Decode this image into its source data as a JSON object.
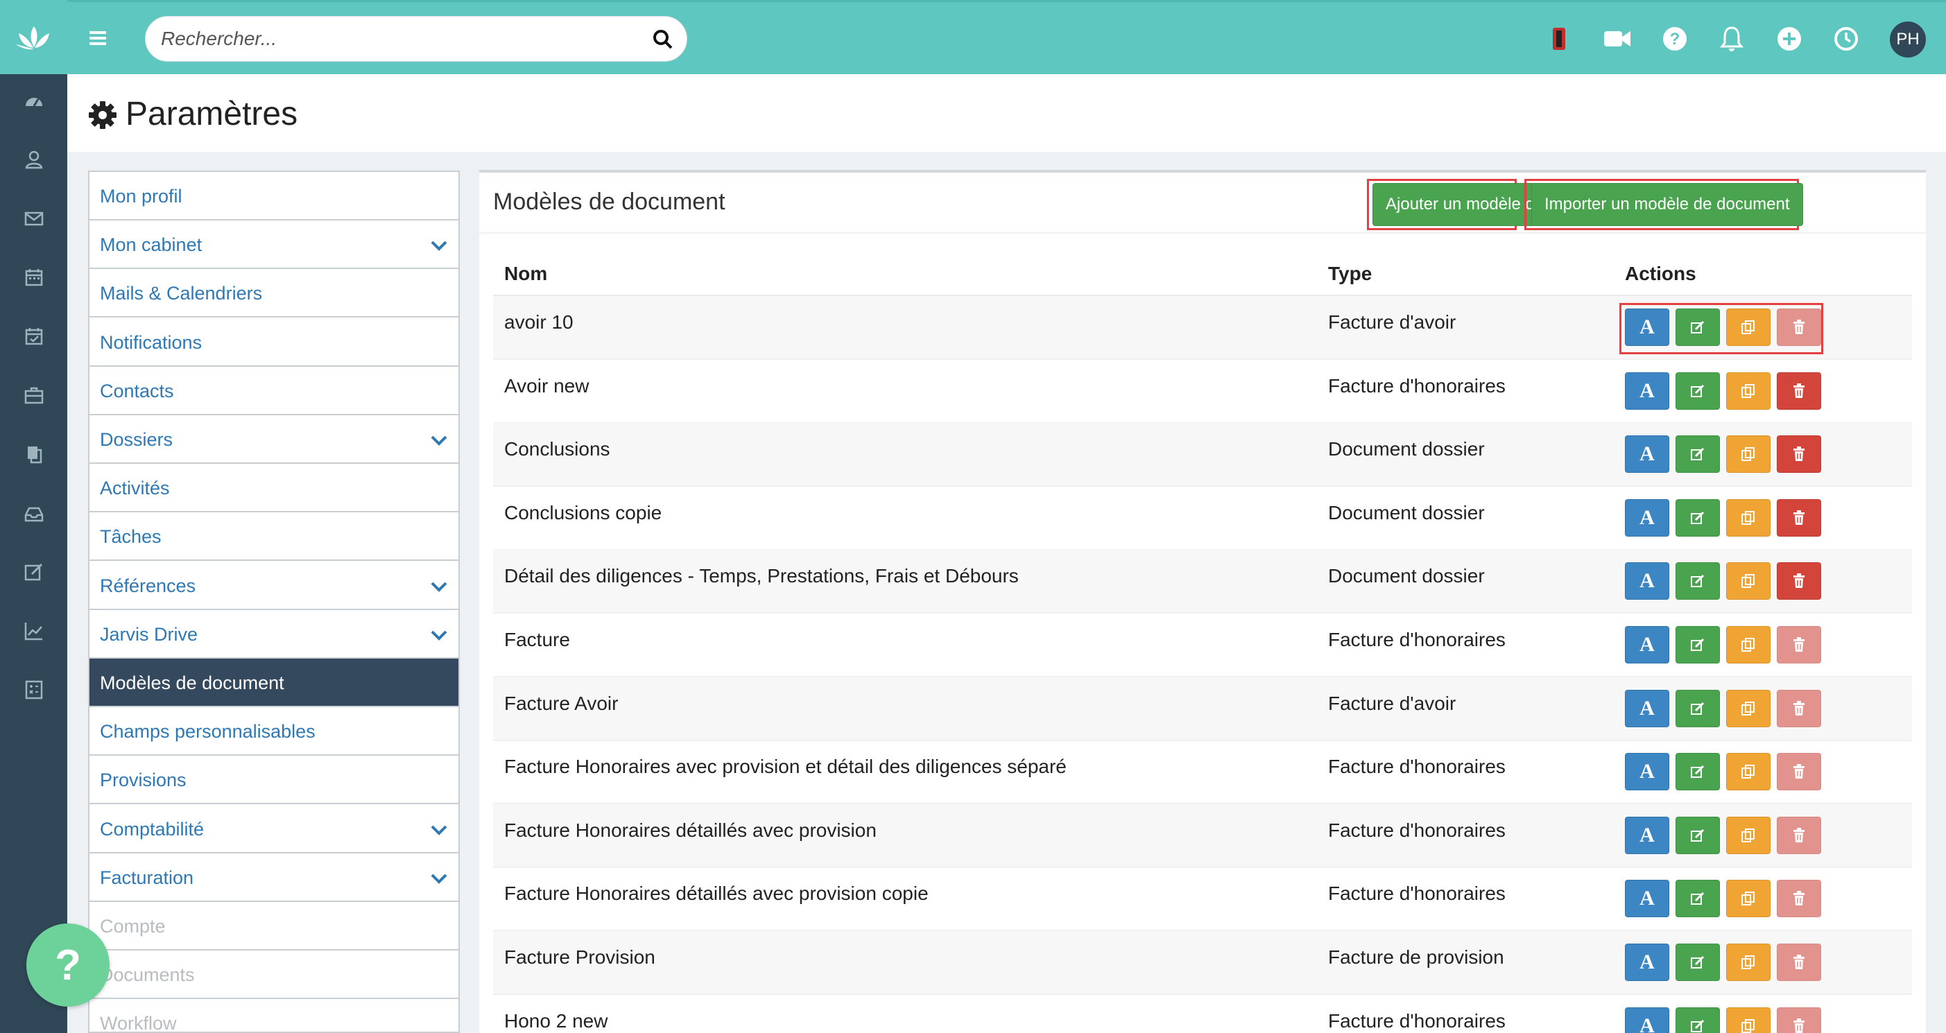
{
  "search": {
    "placeholder": "Rechercher..."
  },
  "user": {
    "initials": "PH"
  },
  "page": {
    "title": "Paramètres"
  },
  "menu": [
    {
      "label": "Mon profil",
      "has_submenu": false,
      "state": "normal"
    },
    {
      "label": "Mon cabinet",
      "has_submenu": true,
      "state": "normal"
    },
    {
      "label": "Mails & Calendriers",
      "has_submenu": false,
      "state": "normal"
    },
    {
      "label": "Notifications",
      "has_submenu": false,
      "state": "normal"
    },
    {
      "label": "Contacts",
      "has_submenu": false,
      "state": "normal"
    },
    {
      "label": "Dossiers",
      "has_submenu": true,
      "state": "normal"
    },
    {
      "label": "Activités",
      "has_submenu": false,
      "state": "normal"
    },
    {
      "label": "Tâches",
      "has_submenu": false,
      "state": "normal"
    },
    {
      "label": "Références",
      "has_submenu": true,
      "state": "normal"
    },
    {
      "label": "Jarvis Drive",
      "has_submenu": true,
      "state": "normal"
    },
    {
      "label": "Modèles de document",
      "has_submenu": false,
      "state": "active"
    },
    {
      "label": "Champs personnalisables",
      "has_submenu": false,
      "state": "normal"
    },
    {
      "label": "Provisions",
      "has_submenu": false,
      "state": "normal"
    },
    {
      "label": "Comptabilité",
      "has_submenu": true,
      "state": "normal"
    },
    {
      "label": "Facturation",
      "has_submenu": true,
      "state": "normal"
    },
    {
      "label": "Compte",
      "has_submenu": false,
      "state": "disabled"
    },
    {
      "label": "Documents",
      "has_submenu": false,
      "state": "disabled"
    },
    {
      "label": "Workflow",
      "has_submenu": false,
      "state": "disabled"
    }
  ],
  "panel": {
    "title": "Modèles de document",
    "add_button": "Ajouter un modèle de document",
    "import_button": "Importer un modèle de document"
  },
  "table": {
    "headers": {
      "name": "Nom",
      "type": "Type",
      "actions": "Actions"
    },
    "rows": [
      {
        "name": "avoir 10",
        "type": "Facture d'avoir",
        "delete_enabled": false
      },
      {
        "name": "Avoir new",
        "type": "Facture d'honoraires",
        "delete_enabled": true
      },
      {
        "name": "Conclusions",
        "type": "Document dossier",
        "delete_enabled": true
      },
      {
        "name": "Conclusions copie",
        "type": "Document dossier",
        "delete_enabled": true
      },
      {
        "name": "Détail des diligences - Temps, Prestations, Frais et Débours",
        "type": "Document dossier",
        "delete_enabled": true
      },
      {
        "name": "Facture",
        "type": "Facture d'honoraires",
        "delete_enabled": false
      },
      {
        "name": "Facture Avoir",
        "type": "Facture d'avoir",
        "delete_enabled": false
      },
      {
        "name": "Facture Honoraires avec provision et détail des diligences séparé",
        "type": "Facture d'honoraires",
        "delete_enabled": false
      },
      {
        "name": "Facture Honoraires détaillés avec provision",
        "type": "Facture d'honoraires",
        "delete_enabled": false
      },
      {
        "name": "Facture Honoraires détaillés avec provision copie",
        "type": "Facture d'honoraires",
        "delete_enabled": false
      },
      {
        "name": "Facture Provision",
        "type": "Facture de provision",
        "delete_enabled": false
      },
      {
        "name": "Hono 2 new",
        "type": "Facture d'honoraires",
        "delete_enabled": false
      }
    ],
    "action_glyph": "A"
  },
  "help": {
    "label": "?"
  },
  "colors": {
    "topbar": "#5ec7c0",
    "rail": "#2f4756",
    "active_menu": "#34495e",
    "link": "#2e78b4",
    "btn_blue": "#3c86c4",
    "btn_green": "#4aa34f",
    "btn_orange": "#efa433",
    "btn_red": "#d3453a",
    "highlight_box": "#e34141"
  },
  "icons": {
    "rail": [
      "dashboard-icon",
      "contacts-icon",
      "mail-icon",
      "calendar-icon",
      "calendar-check-icon",
      "briefcase-icon",
      "documents-icon",
      "inbox-icon",
      "edit-icon",
      "chart-icon",
      "calculator-icon"
    ],
    "topbar": [
      "timer-icon",
      "video-icon",
      "help-icon",
      "bell-icon",
      "plus-circle-icon",
      "clock-icon"
    ]
  }
}
